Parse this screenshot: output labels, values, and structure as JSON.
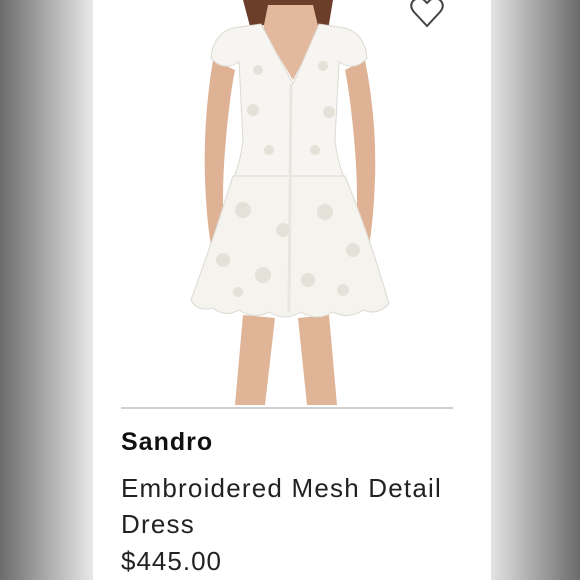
{
  "product": {
    "brand": "Sandro",
    "title": "Embroidered Mesh Detail Dress",
    "price": "$445.00",
    "favorite_icon": "heart-outline-icon",
    "image_subject": "model-wearing-white-embroidered-dress"
  }
}
